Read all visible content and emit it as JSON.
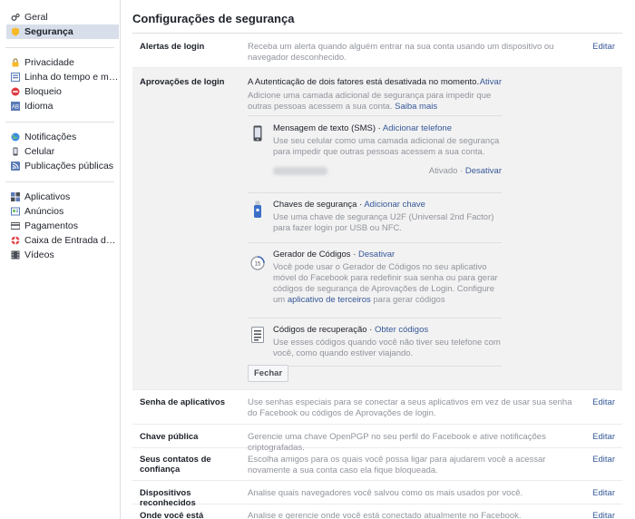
{
  "sidebar": {
    "groups": [
      [
        {
          "label": "Geral",
          "icon": "gears-icon"
        },
        {
          "label": "Segurança",
          "icon": "shield-icon",
          "active": true
        }
      ],
      [
        {
          "label": "Privacidade",
          "icon": "lock-icon"
        },
        {
          "label": "Linha do tempo e marca...",
          "icon": "timeline-icon"
        },
        {
          "label": "Bloqueio",
          "icon": "block-icon"
        },
        {
          "label": "Idioma",
          "icon": "language-icon"
        }
      ],
      [
        {
          "label": "Notificações",
          "icon": "globe-icon"
        },
        {
          "label": "Celular",
          "icon": "phone-icon"
        },
        {
          "label": "Publicações públicas",
          "icon": "rss-icon"
        }
      ],
      [
        {
          "label": "Aplicativos",
          "icon": "apps-icon"
        },
        {
          "label": "Anúncios",
          "icon": "ads-icon"
        },
        {
          "label": "Pagamentos",
          "icon": "payments-icon"
        },
        {
          "label": "Caixa de Entrada de Su...",
          "icon": "lifebuoy-icon"
        },
        {
          "label": "Vídeos",
          "icon": "video-icon"
        }
      ]
    ]
  },
  "page": {
    "title": "Configurações de segurança"
  },
  "edit_label": "Editar",
  "login_alerts": {
    "label": "Alertas de login",
    "desc": "Receba um alerta quando alguém entrar na sua conta usando um dispositivo ou navegador desconhecido."
  },
  "login_approvals": {
    "label": "Aprovações de login",
    "status": "A Autenticação de dois fatores está desativada no momento.",
    "activate": "Ativar",
    "desc": "Adicione uma camada adicional de segurança para impedir que outras pessoas acessem a sua conta.",
    "learn_more": "Saiba mais",
    "sms": {
      "title": "Mensagem de texto (SMS)",
      "action": "Adicionar telefone",
      "desc": "Use seu celular como uma camada adicional de segurança para impedir que outras pessoas acessem a sua conta.",
      "state": "Ativado",
      "disable": "Desativar"
    },
    "keys": {
      "title": "Chaves de segurança",
      "action": "Adicionar chave",
      "desc": "Use uma chave de segurança U2F (Universal 2nd Factor) para fazer login por USB ou NFC."
    },
    "generator": {
      "title": "Gerador de Códigos",
      "action": "Desativar",
      "desc": "Você pode usar o Gerador de Códigos no seu aplicativo móvel do Facebook para redefinir sua senha ou para gerar códigos de segurança de Aprovações de Login. Configure um",
      "link": "aplicativo de terceiros",
      "desc_end": "para gerar códigos"
    },
    "recovery": {
      "title": "Códigos de recuperação",
      "action": "Obter códigos",
      "desc": "Use esses códigos quando você não tiver seu telefone com você, como quando estiver viajando."
    },
    "close": "Fechar"
  },
  "app_passwords": {
    "label": "Senha de aplicativos",
    "desc": "Use senhas especiais para se conectar a seus aplicativos em vez de usar sua senha do Facebook ou códigos de Aprovações de login."
  },
  "public_key": {
    "label": "Chave pública",
    "desc": "Gerencie uma chave OpenPGP no seu perfil do Facebook e ative notificações criptografadas."
  },
  "trusted_contacts": {
    "label": "Seus contatos de confiança",
    "desc": "Escolha amigos para os quais você possa ligar para ajudarem você a acessar novamente a sua conta caso ela fique bloqueada."
  },
  "recognized_devices": {
    "label": "Dispositivos reconhecidos",
    "desc": "Analise quais navegadores você salvou como os mais usados por você."
  },
  "where_logged_in": {
    "label": "Onde você está conectado",
    "desc": "Analise e gerencie onde você está conectado atualmente no Facebook."
  }
}
